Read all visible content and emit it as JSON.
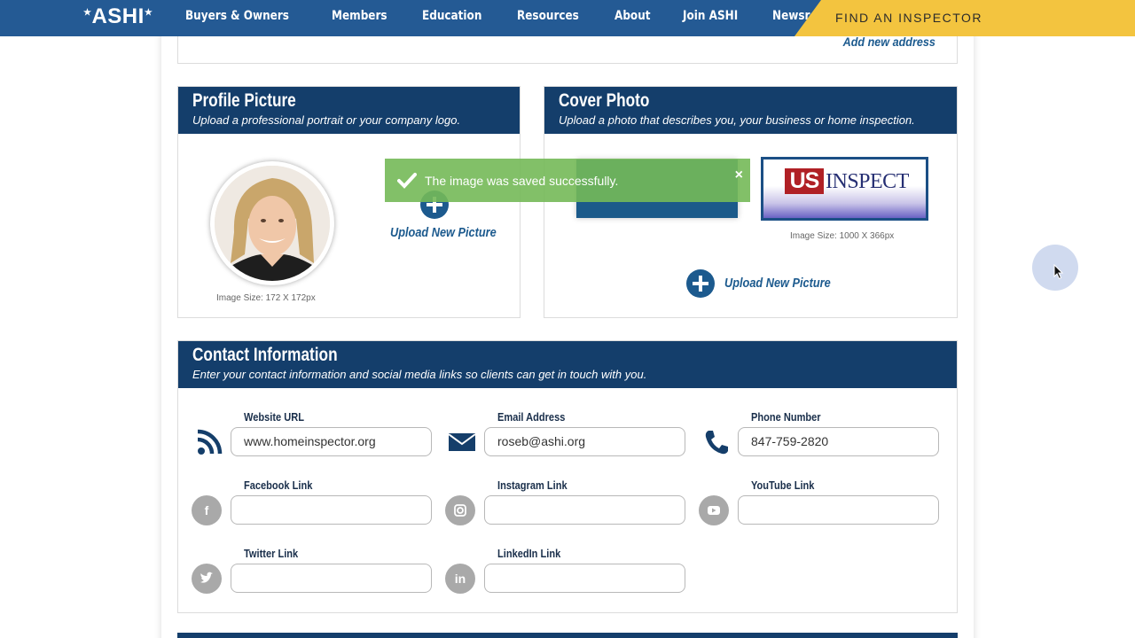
{
  "nav": {
    "logo": "ASHI",
    "links": [
      "Buyers & Owners",
      "Members",
      "Education",
      "Resources",
      "About",
      "Join ASHI",
      "Newsroom"
    ],
    "find_inspector": "FIND AN INSPECTOR"
  },
  "address": {
    "add_new": "Add new address"
  },
  "profile_picture": {
    "title": "Profile Picture",
    "subtitle": "Upload a professional portrait or your company logo.",
    "image_size": "Image Size: 172 X 172px",
    "upload_label": "Upload New Picture"
  },
  "cover_photo": {
    "title": "Cover Photo",
    "subtitle": "Upload a photo that describes you, your business or home inspection.",
    "image_size": "Image Size: 1000 X 366px",
    "upload_label": "Upload New Picture",
    "logo_us": "US",
    "logo_inspect": "INSPECT"
  },
  "toast": {
    "message": "The image was saved successfully.",
    "close": "×"
  },
  "contact": {
    "title": "Contact Information",
    "subtitle": "Enter your contact information and social media links so clients can get in touch with you.",
    "fields": {
      "website": {
        "label": "Website URL",
        "value": "www.homeinspector.org"
      },
      "email": {
        "label": "Email Address",
        "value": "roseb@ashi.org"
      },
      "phone": {
        "label": "Phone Number",
        "value": "847-759-2820"
      },
      "facebook": {
        "label": "Facebook Link",
        "value": ""
      },
      "instagram": {
        "label": "Instagram Link",
        "value": ""
      },
      "youtube": {
        "label": "YouTube Link",
        "value": ""
      },
      "twitter": {
        "label": "Twitter Link",
        "value": ""
      },
      "linkedin": {
        "label": "LinkedIn Link",
        "value": ""
      }
    }
  },
  "colors": {
    "nav_blue": "#245a94",
    "panel_navy": "#143e6b",
    "accent_yellow": "#f3c43f",
    "link_blue": "#1c5a8e",
    "toast_green": "#74b958"
  },
  "icons": [
    "rss-icon",
    "envelope-icon",
    "phone-icon",
    "facebook-icon",
    "instagram-icon",
    "youtube-icon",
    "twitter-icon",
    "linkedin-icon",
    "plus-circle-icon",
    "check-icon",
    "close-icon",
    "mouse-cursor-icon"
  ]
}
